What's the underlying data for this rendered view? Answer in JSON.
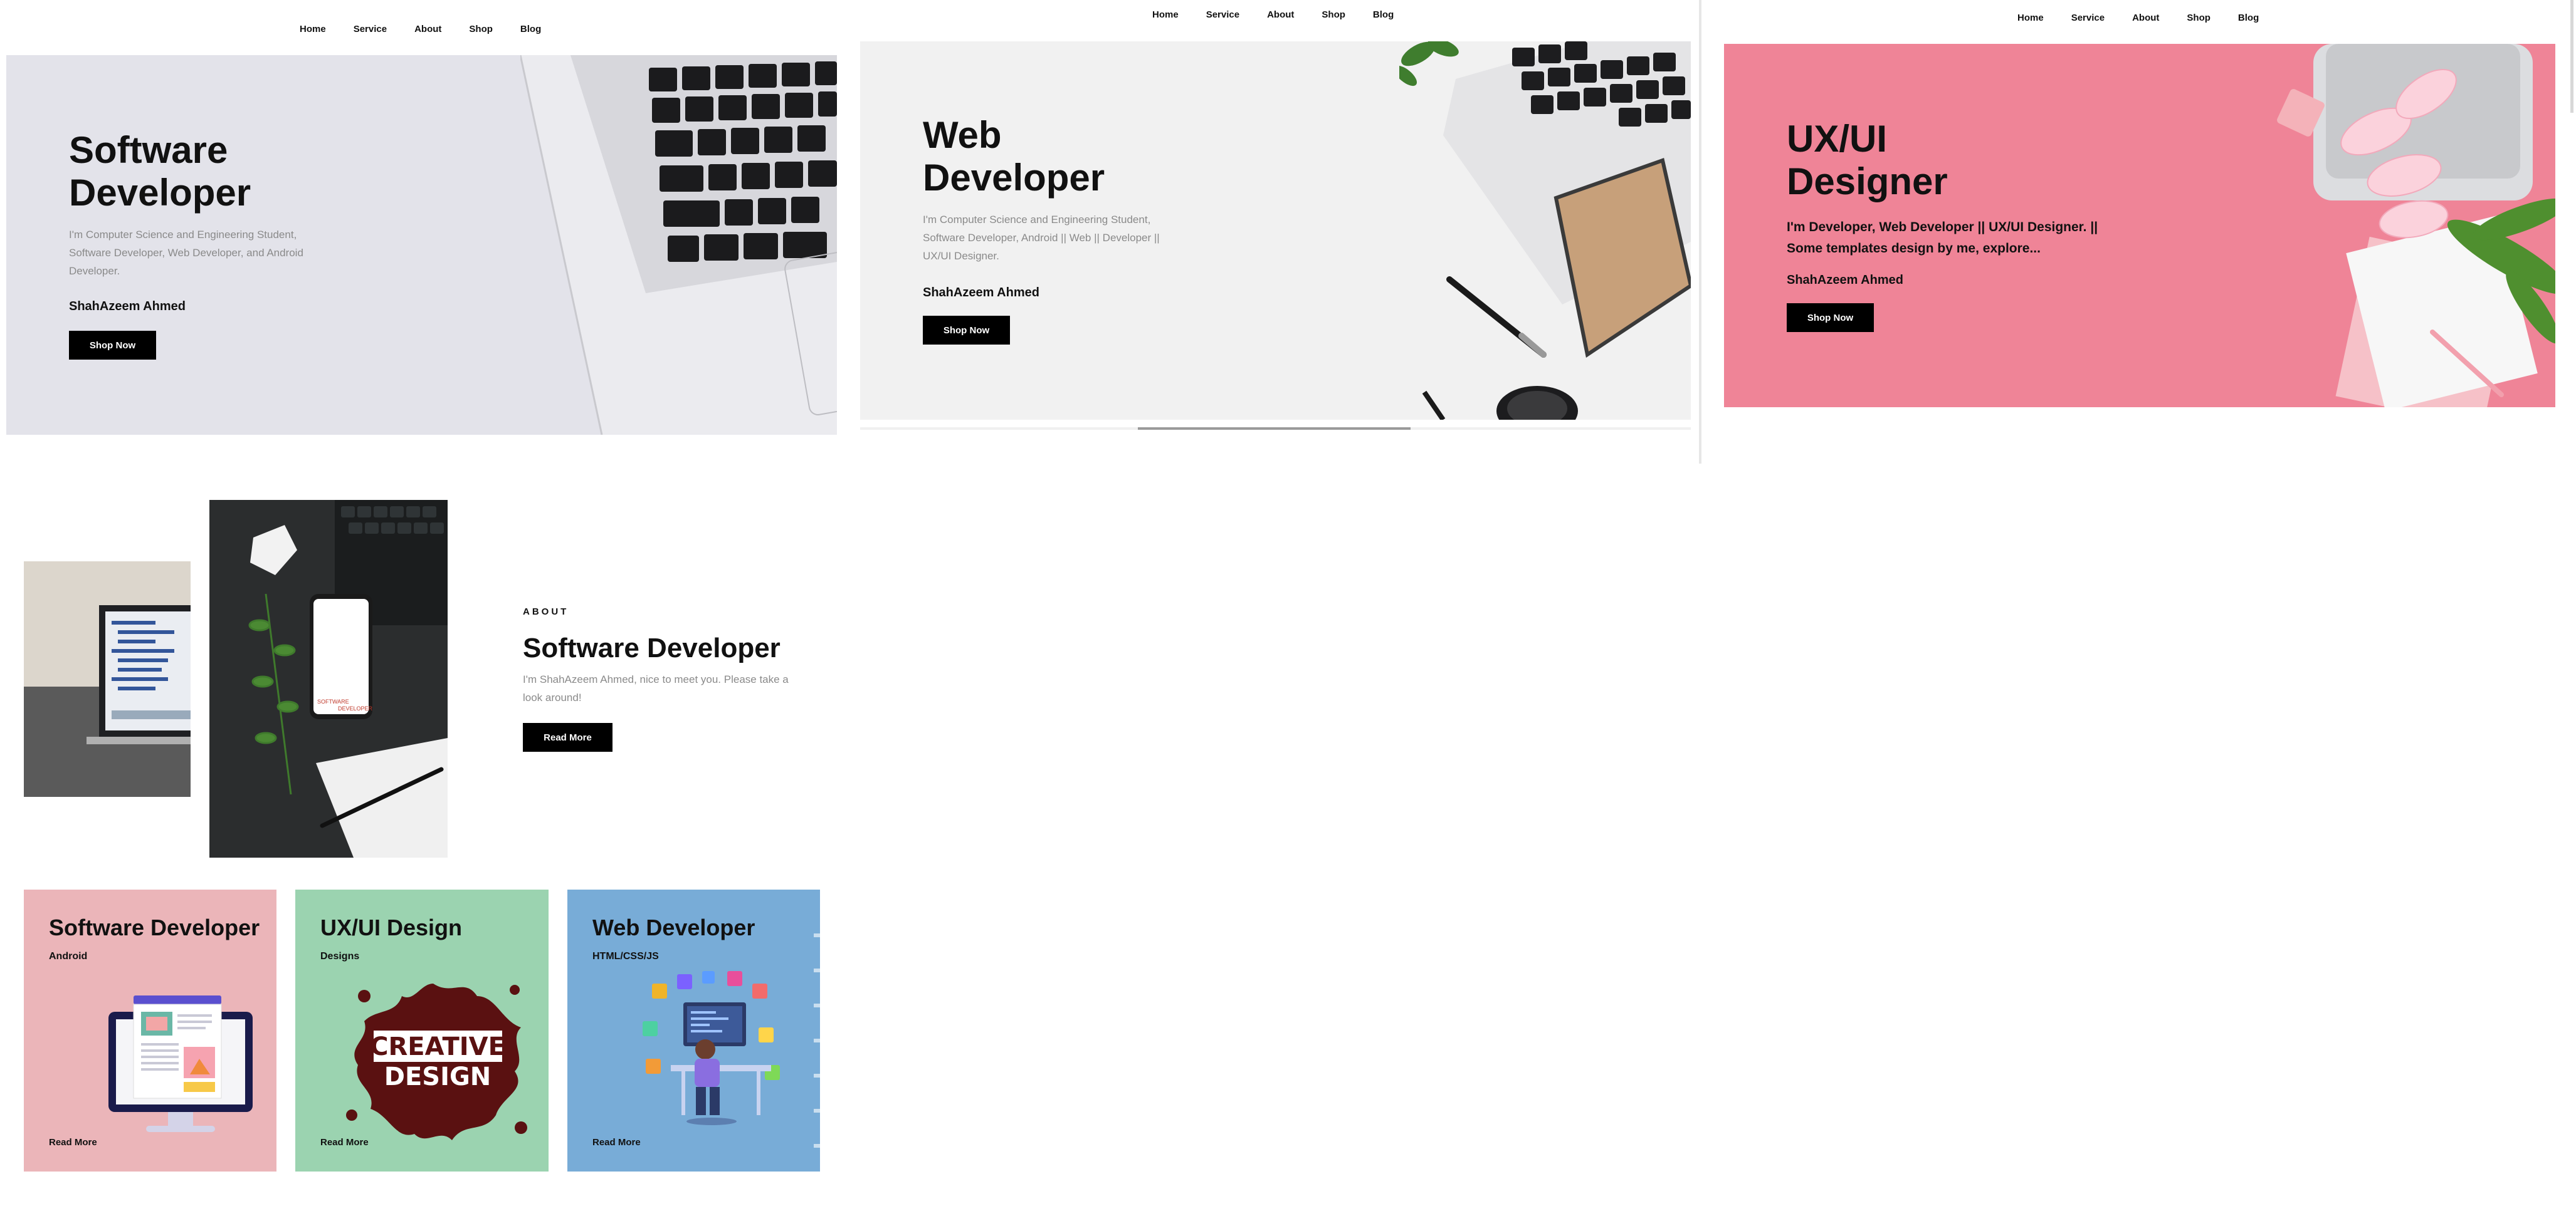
{
  "nav": {
    "items": [
      "Home",
      "Service",
      "About",
      "Shop",
      "Blog"
    ]
  },
  "slides": [
    {
      "title_line1": "Software",
      "title_line2": "Developer",
      "description_line1": "I'm Computer Science and Engineering Student,",
      "description_line2": "Software Developer, Web Developer, and Android",
      "description_line3": "Developer.",
      "author": "ShahAzeem Ahmed",
      "button": "Shop Now",
      "background": "#e3e3ea"
    },
    {
      "title_line1": "Web",
      "title_line2": "Developer",
      "description_line1": "I'm Computer Science and Engineering Student,",
      "description_line2": "Software Developer, Android || Web || Developer ||",
      "description_line3": "UX/UI Designer.",
      "author": "ShahAzeem Ahmed",
      "button": "Shop Now",
      "background": "#f1f1f1"
    },
    {
      "title_line1": "UX/UI",
      "title_line2": "Designer",
      "description_line1": "I'm Developer, Web Developer || UX/UI Designer. ||",
      "description_line2": "Some templates design by me, explore...",
      "author": "ShahAzeem Ahmed",
      "button": "Shop Now",
      "background": "#ef8497"
    }
  ],
  "about": {
    "label": "ABOUT",
    "title": "Software Developer",
    "text_line1": "I'm ShahAzeem Ahmed, nice to meet you. Please take a",
    "text_line2": "look around!",
    "button": "Read More",
    "phone_screen_text1": "SOFTWARE",
    "phone_screen_text2": "DEVELOPER"
  },
  "services": [
    {
      "title": "Software Developer",
      "subtitle": "Android",
      "link": "Read More",
      "color": "#ebb5b9",
      "icon": "monitor-illustration-icon"
    },
    {
      "title": "UX/UI Design",
      "subtitle": "Designs",
      "link": "Read More",
      "color": "#9bd3b0",
      "icon": "creative-design-splash-icon",
      "art_line1": "CREATIVE",
      "art_line2": "DESIGN"
    },
    {
      "title": "Web Developer",
      "subtitle": "HTML/CSS/JS",
      "link": "Read More",
      "color": "#78acd7",
      "icon": "developer-at-desk-icon"
    }
  ]
}
